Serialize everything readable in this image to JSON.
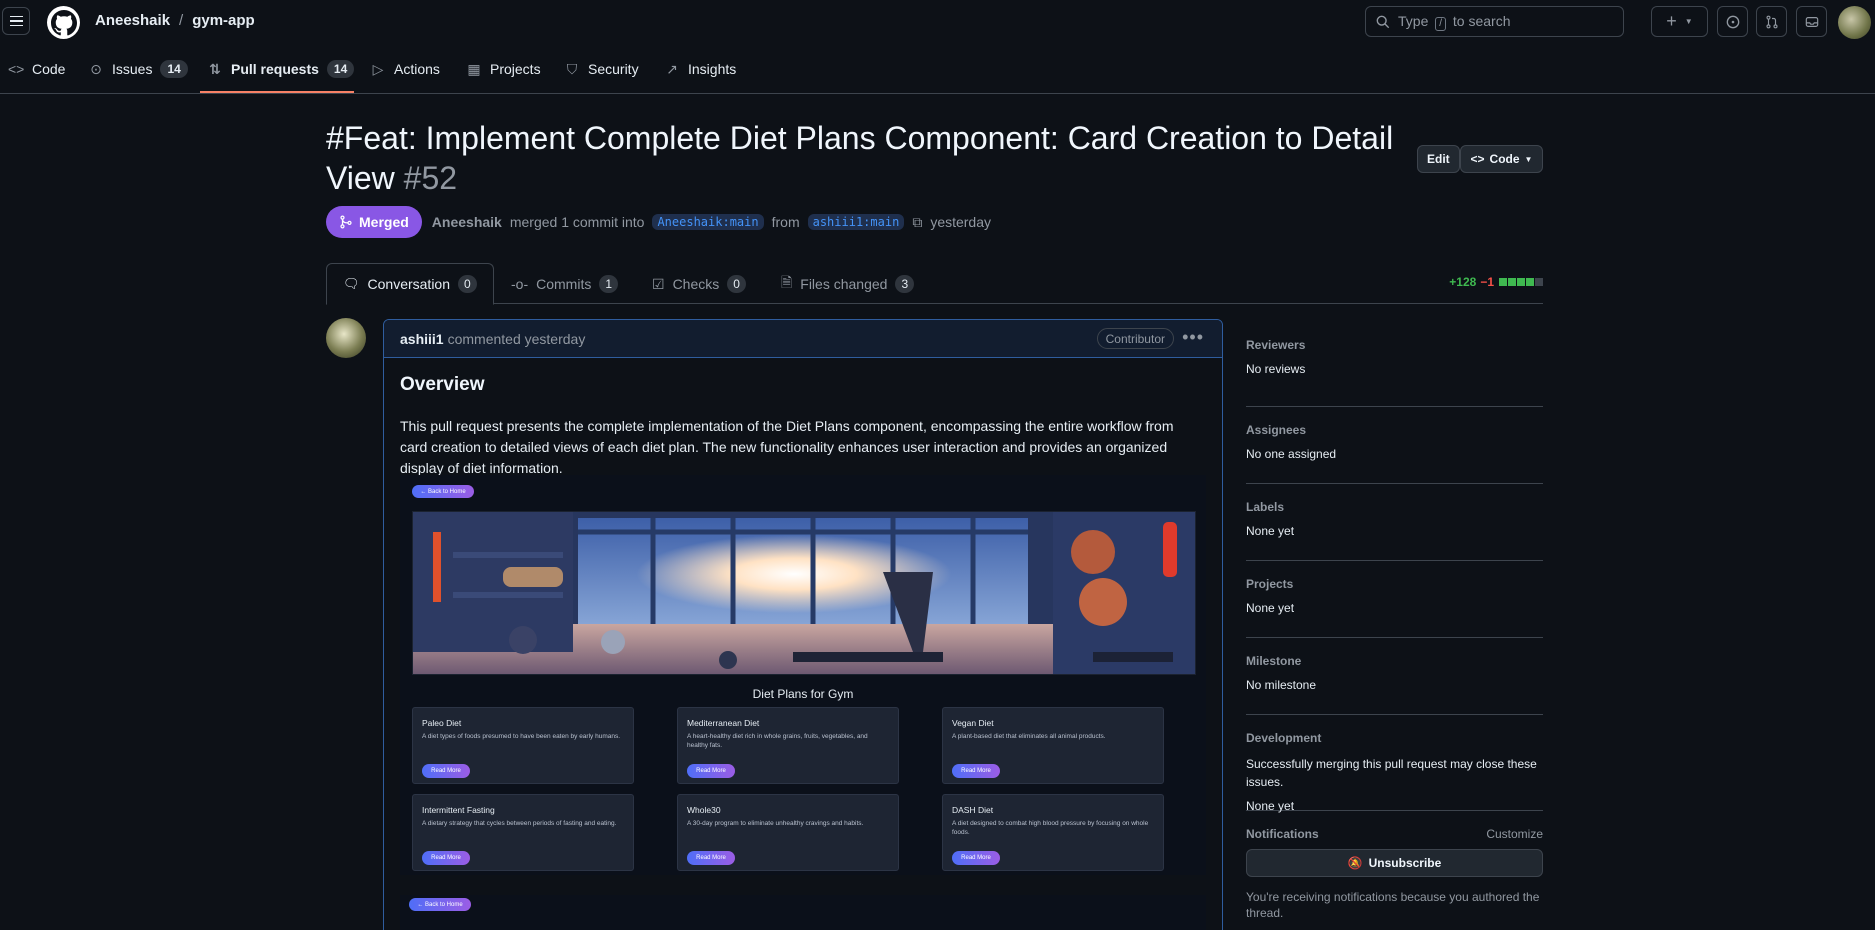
{
  "header": {
    "owner": "Aneeshaik",
    "separator": "/",
    "repo": "gym-app",
    "search_prefix": "Type",
    "search_key": "/",
    "search_suffix": "to search",
    "plus_label": "+"
  },
  "repo_tabs": {
    "code": "Code",
    "issues": "Issues",
    "issues_count": "14",
    "pulls": "Pull requests",
    "pulls_count": "14",
    "actions": "Actions",
    "projects": "Projects",
    "security": "Security",
    "insights": "Insights"
  },
  "pr": {
    "title_line1": "#Feat: Implement Complete Diet Plans Component: Card Creation to Detail",
    "title_line2": "View",
    "number": "#52",
    "edit_label": "Edit",
    "code_label": "Code",
    "status": "Merged",
    "author": "Aneeshaik",
    "merge_text": "merged 1 commit into",
    "base_branch": "Aneeshaik:main",
    "from_text": "from",
    "head_branch": "ashiii1:main",
    "time": "yesterday"
  },
  "pr_tabs": {
    "conversation": "Conversation",
    "conversation_count": "0",
    "commits": "Commits",
    "commits_count": "1",
    "checks": "Checks",
    "checks_count": "0",
    "files": "Files changed",
    "files_count": "3",
    "additions": "+128",
    "deletions": "−1",
    "diff_blocks": [
      "add",
      "add",
      "add",
      "add",
      "neutral"
    ]
  },
  "comment": {
    "author": "ashiii1",
    "action": "commented yesterday",
    "role": "Contributor",
    "heading": "Overview",
    "body": "This pull request presents the complete implementation of the Diet Plans component, encompassing the entire workflow from card creation to detailed views of each diet plan. The new functionality enhances user interaction and provides an organized display of diet information."
  },
  "screenshot": {
    "back_button": "← Back to Home",
    "section_title": "Diet Plans for Gym",
    "read_more": "Read More",
    "cards": [
      {
        "title": "Paleo Diet",
        "desc": "A diet types of foods presumed to have been eaten by early humans."
      },
      {
        "title": "Mediterranean Diet",
        "desc": "A heart-healthy diet rich in whole grains, fruits, vegetables, and healthy fats."
      },
      {
        "title": "Vegan Diet",
        "desc": "A plant-based diet that eliminates all animal products."
      },
      {
        "title": "Intermittent Fasting",
        "desc": "A dietary strategy that cycles between periods of fasting and eating."
      },
      {
        "title": "Whole30",
        "desc": "A 30-day program to eliminate unhealthy cravings and habits."
      },
      {
        "title": "DASH Diet",
        "desc": "A diet designed to combat high blood pressure by focusing on whole foods."
      }
    ],
    "back_button_2": "← Back to Home"
  },
  "sidebar": {
    "reviewers_h": "Reviewers",
    "reviewers_v": "No reviews",
    "assignees_h": "Assignees",
    "assignees_v": "No one assigned",
    "labels_h": "Labels",
    "labels_v": "None yet",
    "projects_h": "Projects",
    "projects_v": "None yet",
    "milestone_h": "Milestone",
    "milestone_v": "No milestone",
    "development_h": "Development",
    "development_text": "Successfully merging this pull request may close these issues.",
    "development_v": "None yet",
    "notifications_h": "Notifications",
    "customize": "Customize",
    "unsubscribe": "Unsubscribe",
    "notif_reason": "You're receiving notifications because you authored the thread."
  },
  "colors": {
    "accent_merged": "#8957e5",
    "tab_underline": "#f78166",
    "add_green": "#3fb950",
    "del_red": "#f85149",
    "link_blue": "#4493f8"
  }
}
